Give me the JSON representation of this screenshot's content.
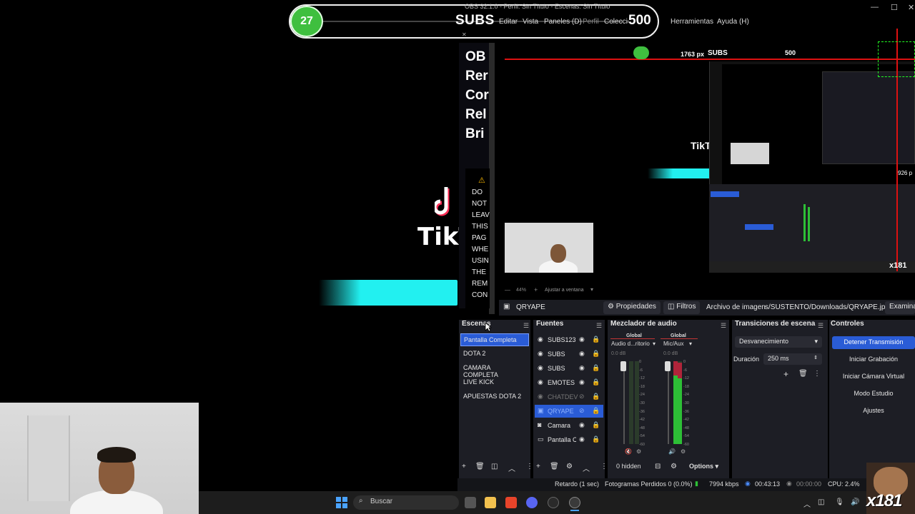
{
  "window": {
    "title": "OBS 32.1.0 - Perfil: Sin Título - Escenas: Sin Título",
    "controls": [
      "—",
      "☐",
      "✕"
    ]
  },
  "overlay": {
    "current_subs": "27",
    "label": "SUBS",
    "goal": "500"
  },
  "menu": {
    "items": [
      "Editar",
      "Vista",
      "Paneles (D)",
      "Perfil",
      "Colección de escenas",
      "Herramientas",
      "Ayuda (H)"
    ]
  },
  "browser_dock": {
    "lines": [
      "OB",
      "Rer",
      "Cor",
      "Rel",
      "Bri"
    ],
    "warning": [
      "DO",
      "NOT",
      "LEAV",
      "THIS",
      "PAG",
      "WHE",
      "USIN",
      "THE",
      "REM",
      "CON"
    ]
  },
  "left_canvas": {
    "brand": "TikT"
  },
  "preview": {
    "px_label": "1763 px",
    "subs_label": "SUBS",
    "goal_label": "500",
    "tiktok": "TikT",
    "nested_920": "926 p",
    "nested_x181": "x181"
  },
  "preview_toolbar": {
    "zoom": "44%",
    "fit": "Ajustar a ventana"
  },
  "source_bar": {
    "source_name": "QRYAPE",
    "properties": "Propiedades",
    "filters": "Filtros",
    "file_label": "Archivo de imagen",
    "file_path": "s/SUSTENTO/Downloads/QRYAPE.jpeg",
    "browse": "Examinar"
  },
  "scenes": {
    "title": "Escenas",
    "items": [
      {
        "label": "Pantalla Completa",
        "active": true
      },
      {
        "label": "DOTA 2",
        "active": false
      },
      {
        "label": "CAMARA COMPLETA",
        "active": false
      },
      {
        "label": "LIVE KICK",
        "active": false
      },
      {
        "label": "APUESTAS DOTA 2",
        "active": false
      }
    ]
  },
  "sources": {
    "title": "Fuentes",
    "items": [
      {
        "label": "SUBS123",
        "icon": "browser-icon",
        "state": "normal"
      },
      {
        "label": "SUBS",
        "icon": "browser-icon",
        "state": "normal"
      },
      {
        "label": "SUBS",
        "icon": "browser-icon",
        "state": "normal"
      },
      {
        "label": "EMOTES",
        "icon": "browser-icon",
        "state": "normal"
      },
      {
        "label": "CHATDEV",
        "icon": "browser-icon",
        "state": "dim"
      },
      {
        "label": "QRYAPE",
        "icon": "image-icon",
        "state": "active"
      },
      {
        "label": "Camara",
        "icon": "camera-icon",
        "state": "normal"
      },
      {
        "label": "Pantalla C",
        "icon": "display-icon",
        "state": "normal"
      }
    ],
    "hidden_count": "0 hidden",
    "options": "Options"
  },
  "mixer": {
    "title": "Mezclador de audio",
    "channels": [
      {
        "global": "Global",
        "name": "Audio d...ritorio",
        "db": "0.0 dB",
        "level": 0.0
      },
      {
        "global": "Global",
        "name": "Mic/Aux",
        "db": "0.0 dB",
        "level": 0.95
      }
    ],
    "scale": [
      "0",
      "-6",
      "-12",
      "-18",
      "-24",
      "-30",
      "-36",
      "-42",
      "-48",
      "-54",
      "-60"
    ]
  },
  "transitions": {
    "title": "Transiciones de escena",
    "type": "Desvanecimiento",
    "duration_label": "Duración",
    "duration_value": "250 ms"
  },
  "controls": {
    "title": "Controles",
    "buttons": [
      "Detener Transmisión",
      "Iniciar Grabación",
      "Iniciar Cámara Virtual",
      "Modo Estudio",
      "Ajustes"
    ]
  },
  "statusbar": {
    "delay": "Retardo (1 sec)",
    "dropped": "Fotogramas Perdidos 0 (0.0%)",
    "bitrate": "7994 kbps",
    "live_time": "00:43:13",
    "rec_time": "00:00:00",
    "cpu": "CPU: 2.4%"
  },
  "taskbar": {
    "search": "Buscar"
  },
  "emote": {
    "text": "x181"
  },
  "colors": {
    "accent": "#2a5cd6",
    "green": "#3fbf3f",
    "cyan": "#22f0f0",
    "red": "#d11111"
  }
}
